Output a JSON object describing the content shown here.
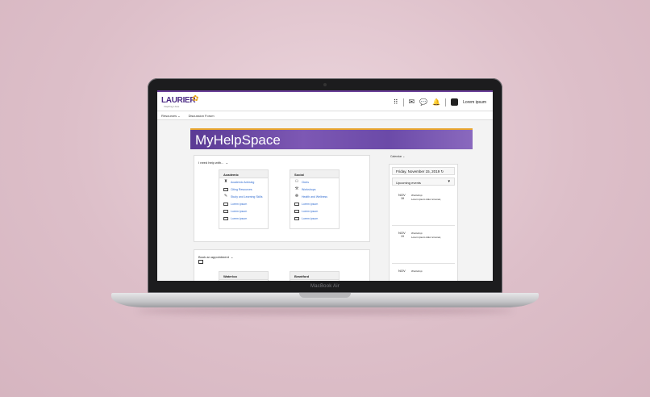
{
  "device": {
    "brand": "MacBook Air"
  },
  "header": {
    "logo": "LAURIER",
    "logo_sub": "Inspiring Lives.",
    "user_name": "Lorem ipsum"
  },
  "nav": {
    "items": [
      "Resources",
      "Discussion Forum"
    ]
  },
  "banner": {
    "title": "MyHelpSpace"
  },
  "help": {
    "title": "I need help with...",
    "academic": {
      "heading": "Academic",
      "items": [
        "Academic Advising",
        "Citing Resources",
        "Study and Learning Skills",
        "Lorem ipsum",
        "Lorem ipsum",
        "Lorem ipsum"
      ]
    },
    "social": {
      "heading": "Social",
      "items": [
        "Clubs",
        "Workshops",
        "Health and Wellness",
        "Lorem ipsum",
        "Lorem ipsum",
        "Lorem ipsum"
      ]
    }
  },
  "appointment": {
    "title": "Book an appointment",
    "locations": [
      "Waterloo",
      "Brantford"
    ]
  },
  "calendar": {
    "label": "Calendar",
    "date": "Friday, November 15, 2019",
    "upcoming": "Upcoming events",
    "events": [
      {
        "month": "NOV",
        "day": "18",
        "name": "Workshop",
        "desc": "Lorem ipsum dolor sit amet,"
      },
      {
        "month": "NOV",
        "day": "19",
        "name": "Workshop",
        "desc": "Lorem ipsum dolor sit amet,"
      },
      {
        "month": "NOV",
        "day": "",
        "name": "Workshop",
        "desc": ""
      }
    ]
  },
  "colors": {
    "brand": "#4d2c86",
    "accent": "#e8a21a",
    "link": "#2f6bd0"
  }
}
